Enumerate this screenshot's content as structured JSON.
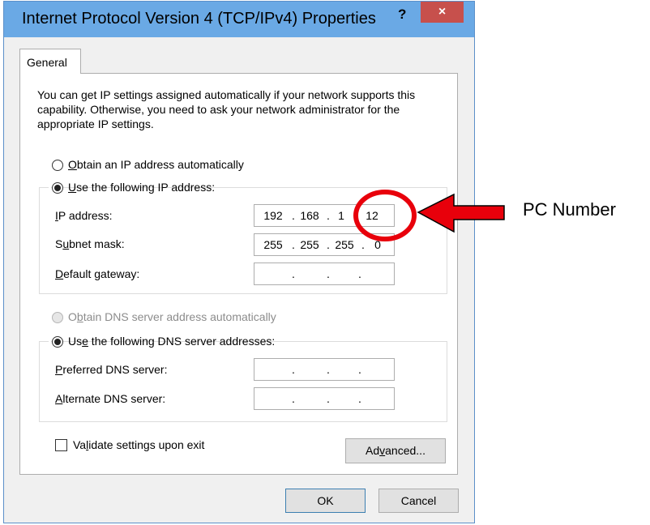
{
  "window": {
    "title": "Internet Protocol Version 4 (TCP/IPv4) Properties",
    "help_icon": "?",
    "close_icon": "×"
  },
  "tabs": [
    {
      "label": "General"
    }
  ],
  "intro": "You can get IP settings assigned automatically if your network supports this capability. Otherwise, you need to ask your network administrator for the appropriate IP settings.",
  "ip_section": {
    "auto": {
      "label_pre": "",
      "label_ul": "O",
      "label_post": "btain an IP address automatically",
      "checked": false
    },
    "manual": {
      "label_pre": "",
      "label_ul": "U",
      "label_post": "se the following IP address:",
      "checked": true
    },
    "ip_address": {
      "label_pre": "",
      "label_ul": "I",
      "label_post": "P address:",
      "octets": [
        "192",
        "168",
        "1",
        "12"
      ]
    },
    "subnet_mask": {
      "label_pre": "S",
      "label_ul": "u",
      "label_post": "bnet mask:",
      "octets": [
        "255",
        "255",
        "255",
        "0"
      ]
    },
    "default_gateway": {
      "label_pre": "",
      "label_ul": "D",
      "label_post": "efault gateway:",
      "octets": [
        "",
        "",
        "",
        ""
      ]
    }
  },
  "dns_section": {
    "auto": {
      "label_pre": "O",
      "label_ul": "b",
      "label_post": "tain DNS server address automatically",
      "checked": false,
      "disabled": true
    },
    "manual": {
      "label_pre": "Us",
      "label_ul": "e",
      "label_post": " the following DNS server addresses:",
      "checked": true
    },
    "preferred": {
      "label_pre": "",
      "label_ul": "P",
      "label_post": "referred DNS server:",
      "octets": [
        "",
        "",
        "",
        ""
      ]
    },
    "alternate": {
      "label_pre": "",
      "label_ul": "A",
      "label_post": "lternate DNS server:",
      "octets": [
        "",
        "",
        "",
        ""
      ]
    }
  },
  "validate": {
    "label_pre": "Va",
    "label_ul": "l",
    "label_post": "idate settings upon exit",
    "checked": false
  },
  "advanced_button": {
    "label_pre": "Ad",
    "label_ul": "v",
    "label_post": "anced..."
  },
  "ok_button": {
    "label": "OK"
  },
  "cancel_button": {
    "label": "Cancel"
  },
  "annotation": {
    "label": "PC Number",
    "color": "#e8000b"
  }
}
